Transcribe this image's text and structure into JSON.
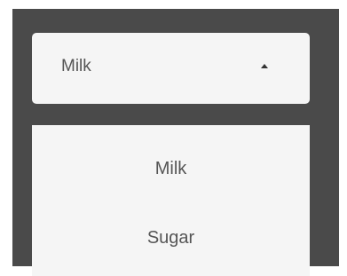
{
  "select": {
    "value": "Milk",
    "arrow_icon": "caret-up-icon"
  },
  "menu": {
    "options": [
      {
        "label": "Milk"
      },
      {
        "label": "Sugar"
      }
    ]
  }
}
